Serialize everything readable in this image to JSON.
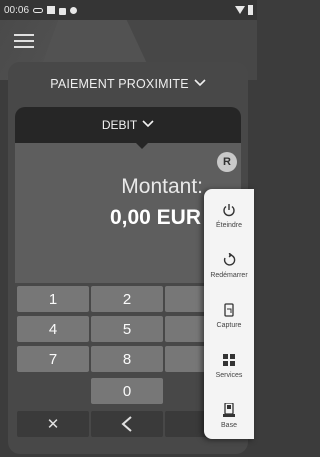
{
  "status_bar": {
    "time": "00:06"
  },
  "header": {
    "mode_label": "PAIEMENT PROXIMITE",
    "transaction_type": "DEBIT"
  },
  "amount": {
    "badge": "R",
    "label": "Montant:",
    "value": "0,00  EUR"
  },
  "keypad": {
    "keys": [
      "1",
      "2",
      "4",
      "5",
      "7",
      "8",
      "0"
    ],
    "clear_symbol": "✕",
    "back_symbol": "‹"
  },
  "power_menu": {
    "items": [
      {
        "label": "Éteindre",
        "icon": "power-icon"
      },
      {
        "label": "Redémarrer",
        "icon": "restart-icon"
      },
      {
        "label": "Capture",
        "icon": "screenshot-icon"
      },
      {
        "label": "Services",
        "icon": "grid-icon"
      },
      {
        "label": "Base",
        "icon": "device-icon"
      }
    ]
  }
}
